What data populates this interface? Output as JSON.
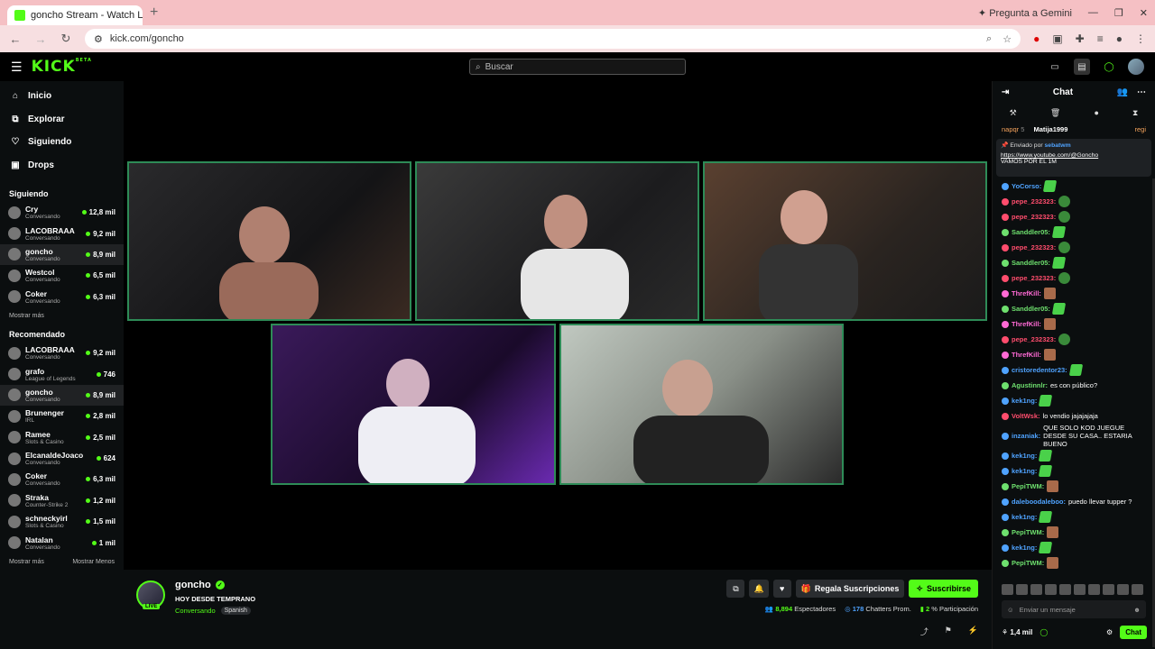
{
  "browser": {
    "tab_title": "goncho Stream - Watch Liv",
    "url": "kick.com/goncho",
    "gemini": "Pregunta a Gemini"
  },
  "header": {
    "logo": "KICK",
    "logo_beta": "BETA",
    "search_placeholder": "Buscar"
  },
  "sidebar": {
    "nav": [
      {
        "label": "Inicio",
        "icon": "home-icon"
      },
      {
        "label": "Explorar",
        "icon": "compass-icon"
      },
      {
        "label": "Siguiendo",
        "icon": "heart-icon"
      },
      {
        "label": "Drops",
        "icon": "gift-icon"
      }
    ],
    "following_title": "Siguiendo",
    "following": [
      {
        "name": "Cry",
        "cat": "Conversando",
        "views": "12,8 mil"
      },
      {
        "name": "LACOBRAAA",
        "cat": "Conversando",
        "views": "9,2 mil"
      },
      {
        "name": "goncho",
        "cat": "Conversando",
        "views": "8,9 mil"
      },
      {
        "name": "Westcol",
        "cat": "Conversando",
        "views": "6,5 mil"
      },
      {
        "name": "Coker",
        "cat": "Conversando",
        "views": "6,3 mil"
      }
    ],
    "show_more": "Mostrar más",
    "recommended_title": "Recomendado",
    "recommended": [
      {
        "name": "LACOBRAAA",
        "cat": "Conversando",
        "views": "9,2 mil"
      },
      {
        "name": "grafo",
        "cat": "League of Legends",
        "views": "746"
      },
      {
        "name": "goncho",
        "cat": "Conversando",
        "views": "8,9 mil"
      },
      {
        "name": "Brunenger",
        "cat": "IRL",
        "views": "2,8 mil"
      },
      {
        "name": "Ramee",
        "cat": "Slots & Casino",
        "views": "2,5 mil"
      },
      {
        "name": "ElcanaldeJoaco",
        "cat": "Conversando",
        "views": "624"
      },
      {
        "name": "Coker",
        "cat": "Conversando",
        "views": "6,3 mil"
      },
      {
        "name": "Straka",
        "cat": "Counter-Strike 2",
        "views": "1,2 mil"
      },
      {
        "name": "schneckyirl",
        "cat": "Slots & Casino",
        "views": "1,5 mil"
      },
      {
        "name": "Natalan",
        "cat": "Conversando",
        "views": "1 mil"
      }
    ],
    "show_more2": "Mostrar más",
    "show_less": "Mostrar Menos"
  },
  "stream": {
    "name": "goncho",
    "title": "HOY DESDE TEMPRANO",
    "category": "Conversando",
    "tag": "Spanish",
    "live": "LIVE",
    "gift_label": "Regala Suscripciones",
    "sub_label": "Suscribirse",
    "viewers": "8,894",
    "viewers_label": "Espectadores",
    "chatters": "178",
    "chatters_label": "Chatters Prom.",
    "participation": "2",
    "participation_label": "% Participación"
  },
  "chat": {
    "title": "Chat",
    "top_row": {
      "user1": "napqr",
      "num": "5",
      "user2": "Matija1999",
      "user3": "regi"
    },
    "pinned_by_label": "Enviado por",
    "pinned_by": "sebatwm",
    "pinned_link": "https://www.youtube.com/@Goncho",
    "pinned_text": "VAMOS POR EL 1M",
    "messages": [
      {
        "user": "YoCorso:",
        "color": "#4fa3ff",
        "text": "",
        "emote": "green"
      },
      {
        "user": "pepe_232323:",
        "color": "#ff4d6d",
        "text": "",
        "emote": "pepe"
      },
      {
        "user": "pepe_232323:",
        "color": "#ff4d6d",
        "text": "",
        "emote": "pepe"
      },
      {
        "user": "Sanddler05:",
        "color": "#6ee06e",
        "text": "",
        "emote": "green"
      },
      {
        "user": "pepe_232323:",
        "color": "#ff4d6d",
        "text": "",
        "emote": "pepe"
      },
      {
        "user": "Sanddler05:",
        "color": "#6ee06e",
        "text": "",
        "emote": "green"
      },
      {
        "user": "pepe_232323:",
        "color": "#ff4d6d",
        "text": "",
        "emote": "pepe"
      },
      {
        "user": "ThrefKill:",
        "color": "#ff6ad5",
        "text": "",
        "emote": "face"
      },
      {
        "user": "Sanddler05:",
        "color": "#6ee06e",
        "text": "",
        "emote": "green"
      },
      {
        "user": "ThrefKill:",
        "color": "#ff6ad5",
        "text": "",
        "emote": "face"
      },
      {
        "user": "pepe_232323:",
        "color": "#ff4d6d",
        "text": "",
        "emote": "pepe"
      },
      {
        "user": "ThrefKill:",
        "color": "#ff6ad5",
        "text": "",
        "emote": "face"
      },
      {
        "user": "cristoredentor23:",
        "color": "#4fa3ff",
        "text": "",
        "emote": "green"
      },
      {
        "user": "Agustinnlr:",
        "color": "#6ee06e",
        "text": "es con público?",
        "emote": ""
      },
      {
        "user": "kek1ng:",
        "color": "#4fa3ff",
        "text": "",
        "emote": "green"
      },
      {
        "user": "VoltWsk:",
        "color": "#ff4d6d",
        "text": "lo vendio jajajajaja",
        "emote": ""
      },
      {
        "user": "inzaniak:",
        "color": "#4fa3ff",
        "text": "QUE SOLO KOD JUEGUE DESDE SU CASA.. ESTARIA BUENO",
        "emote": ""
      },
      {
        "user": "kek1ng:",
        "color": "#4fa3ff",
        "text": "",
        "emote": "green"
      },
      {
        "user": "kek1ng:",
        "color": "#4fa3ff",
        "text": "",
        "emote": "green"
      },
      {
        "user": "PepiTWM:",
        "color": "#6ee06e",
        "text": "",
        "emote": "face"
      },
      {
        "user": "daleboodaleboo:",
        "color": "#4fa3ff",
        "text": "puedo llevar tupper ?",
        "emote": ""
      },
      {
        "user": "kek1ng:",
        "color": "#4fa3ff",
        "text": "",
        "emote": "green"
      },
      {
        "user": "PepiTWM:",
        "color": "#6ee06e",
        "text": "",
        "emote": "face"
      },
      {
        "user": "kek1ng:",
        "color": "#4fa3ff",
        "text": "",
        "emote": "green"
      },
      {
        "user": "PepiTWM:",
        "color": "#6ee06e",
        "text": "",
        "emote": "face"
      }
    ],
    "input_placeholder": "Enviar un mensaje",
    "points": "1,4 mil",
    "send": "Chat"
  },
  "colors": {
    "accent": "#53fc18",
    "bg": "#0b0e0f"
  }
}
